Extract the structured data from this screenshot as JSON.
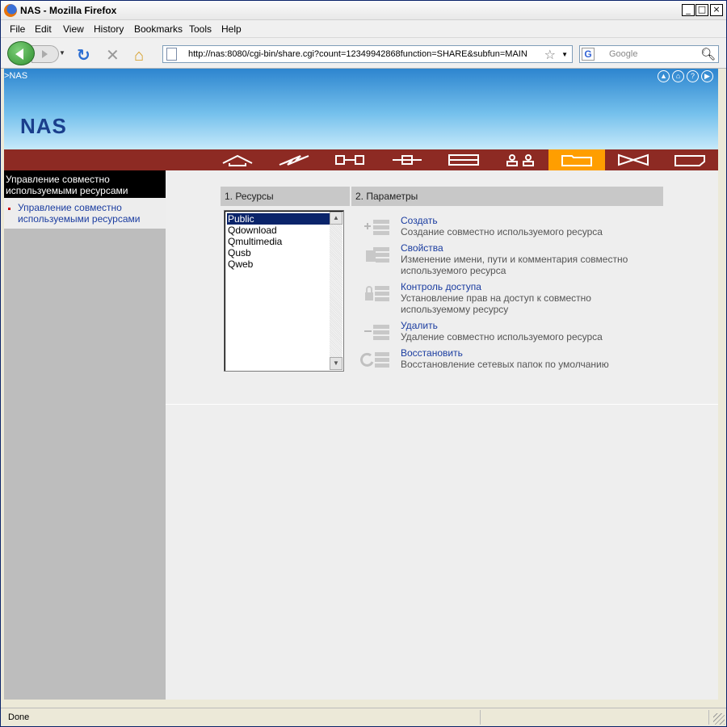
{
  "window": {
    "title": "NAS - Mozilla Firefox"
  },
  "menu": [
    "File",
    "Edit",
    "View",
    "History",
    "Bookmarks",
    "Tools",
    "Help"
  ],
  "address": {
    "url": "http://nas:8080/cgi-bin/share.cgi?count=12349942868function=SHARE&subfun=MAIN"
  },
  "search": {
    "placeholder": "Google"
  },
  "banner": {
    "breadcrumb": ">NAS",
    "logo": "NAS"
  },
  "sidebar": {
    "header": "Управление совместно используемыми ресурсами",
    "items": [
      {
        "label": "Управление совместно используемыми ресурсами"
      }
    ]
  },
  "panels": {
    "resources_title": "1. Ресурсы",
    "params_title": "2. Параметры"
  },
  "resources": [
    "Public",
    "Qdownload",
    "Qmultimedia",
    "Qusb",
    "Qweb"
  ],
  "selected_resource": "Public",
  "actions": [
    {
      "link": "Создать",
      "desc": "Создание совместно используемого ресурса",
      "icon": "add-share-icon"
    },
    {
      "link": "Свойства",
      "desc": "Изменение имени, пути и комментария совместно используемого ресурса",
      "icon": "properties-icon"
    },
    {
      "link": "Контроль доступа",
      "desc": "Установление прав на доступ к совместно используемому ресурсу",
      "icon": "access-control-icon"
    },
    {
      "link": "Удалить",
      "desc": "Удаление совместно используемого ресурса",
      "icon": "delete-share-icon"
    },
    {
      "link": "Восстановить",
      "desc": "Восстановление сетевых папок по умолчанию",
      "icon": "restore-icon"
    }
  ],
  "status": {
    "text": "Done"
  },
  "colors": {
    "nav_bar": "#8d2a23",
    "nav_active": "#ff9e00",
    "link": "#1a3ca0",
    "logo": "#1a3e8c"
  }
}
